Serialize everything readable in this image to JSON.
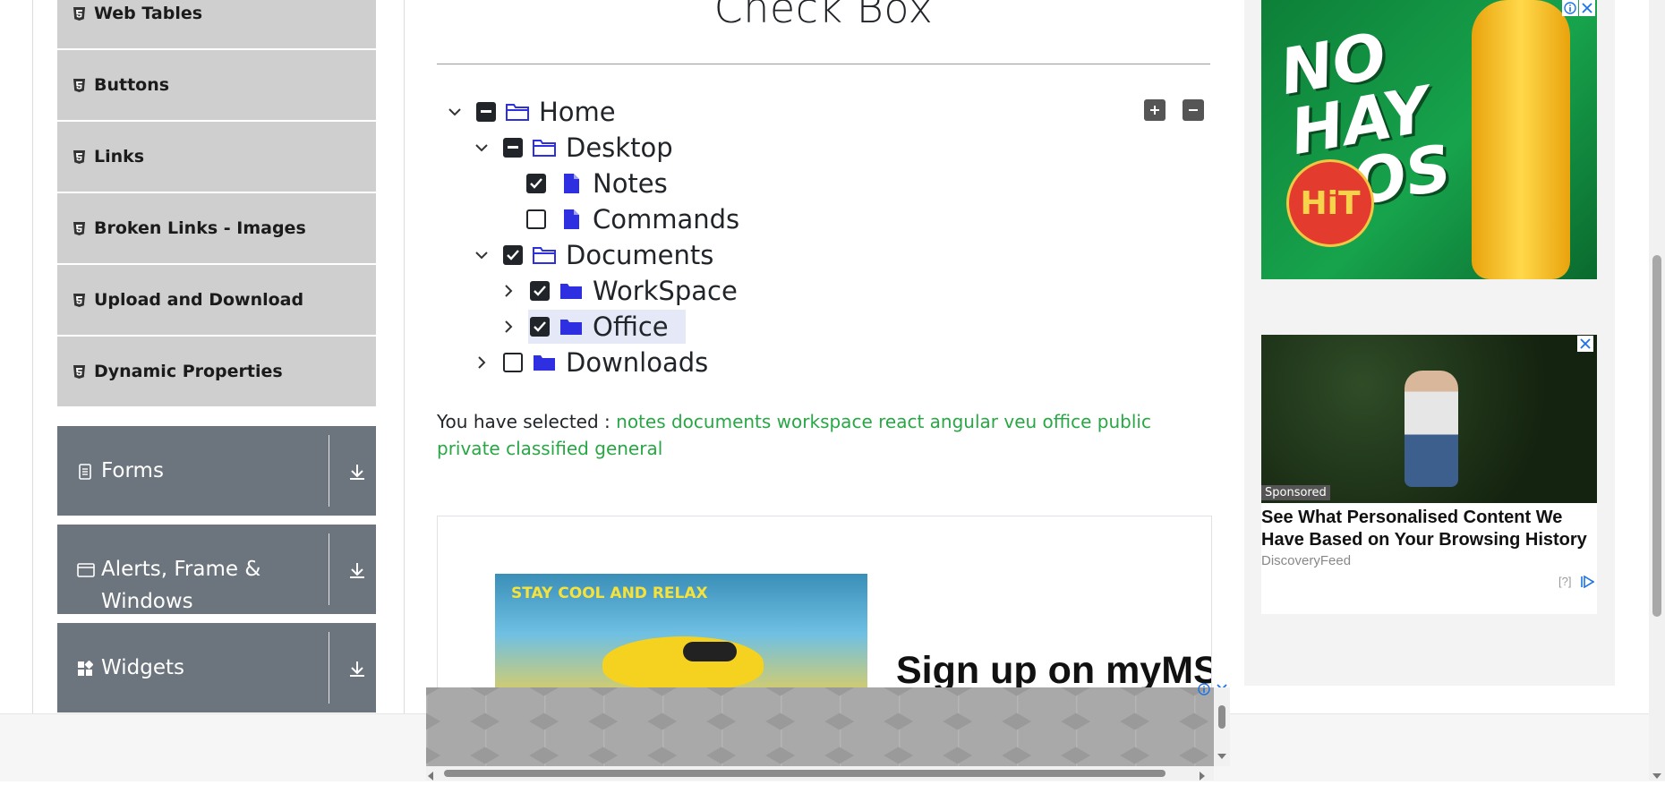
{
  "sidebar": {
    "elements_items": [
      {
        "label": "Web Tables"
      },
      {
        "label": "Buttons"
      },
      {
        "label": "Links"
      },
      {
        "label": "Broken Links - Images"
      },
      {
        "label": "Upload and Download"
      },
      {
        "label": "Dynamic Properties"
      }
    ],
    "groups": [
      {
        "label": "Forms",
        "icon": "document-icon"
      },
      {
        "label": "Alerts, Frame & Windows",
        "icon": "window-icon"
      },
      {
        "label": "Widgets",
        "icon": "widgets-icon"
      }
    ]
  },
  "main": {
    "title": "Check Box",
    "tree": {
      "home": "Home",
      "desktop": "Desktop",
      "notes": "Notes",
      "commands": "Commands",
      "documents": "Documents",
      "workspace": "WorkSpace",
      "office": "Office",
      "downloads": "Downloads"
    },
    "result_label": "You have selected :",
    "selected": [
      "notes",
      "documents",
      "workspace",
      "react",
      "angular",
      "veu",
      "office",
      "public",
      "private",
      "classified",
      "general"
    ]
  },
  "ads": {
    "inline_banner_text": "STAY COOL AND RELAX",
    "inline_heading": "Sign up on myMSC",
    "right1_text": "NO HAY DOS",
    "right1_logo": "HiT",
    "right2_sponsored": "Sponsored",
    "right2_headline": "See What Personalised Content We Have Based on Your Browsing History",
    "right2_source": "DiscoveryFeed",
    "right2_help": "[?]"
  },
  "colors": {
    "accent_green": "#28a745",
    "folder_blue": "#2e2fe0",
    "sidebar_item_bg": "#cfcfcf",
    "sidebar_group_bg": "#6c757d"
  }
}
